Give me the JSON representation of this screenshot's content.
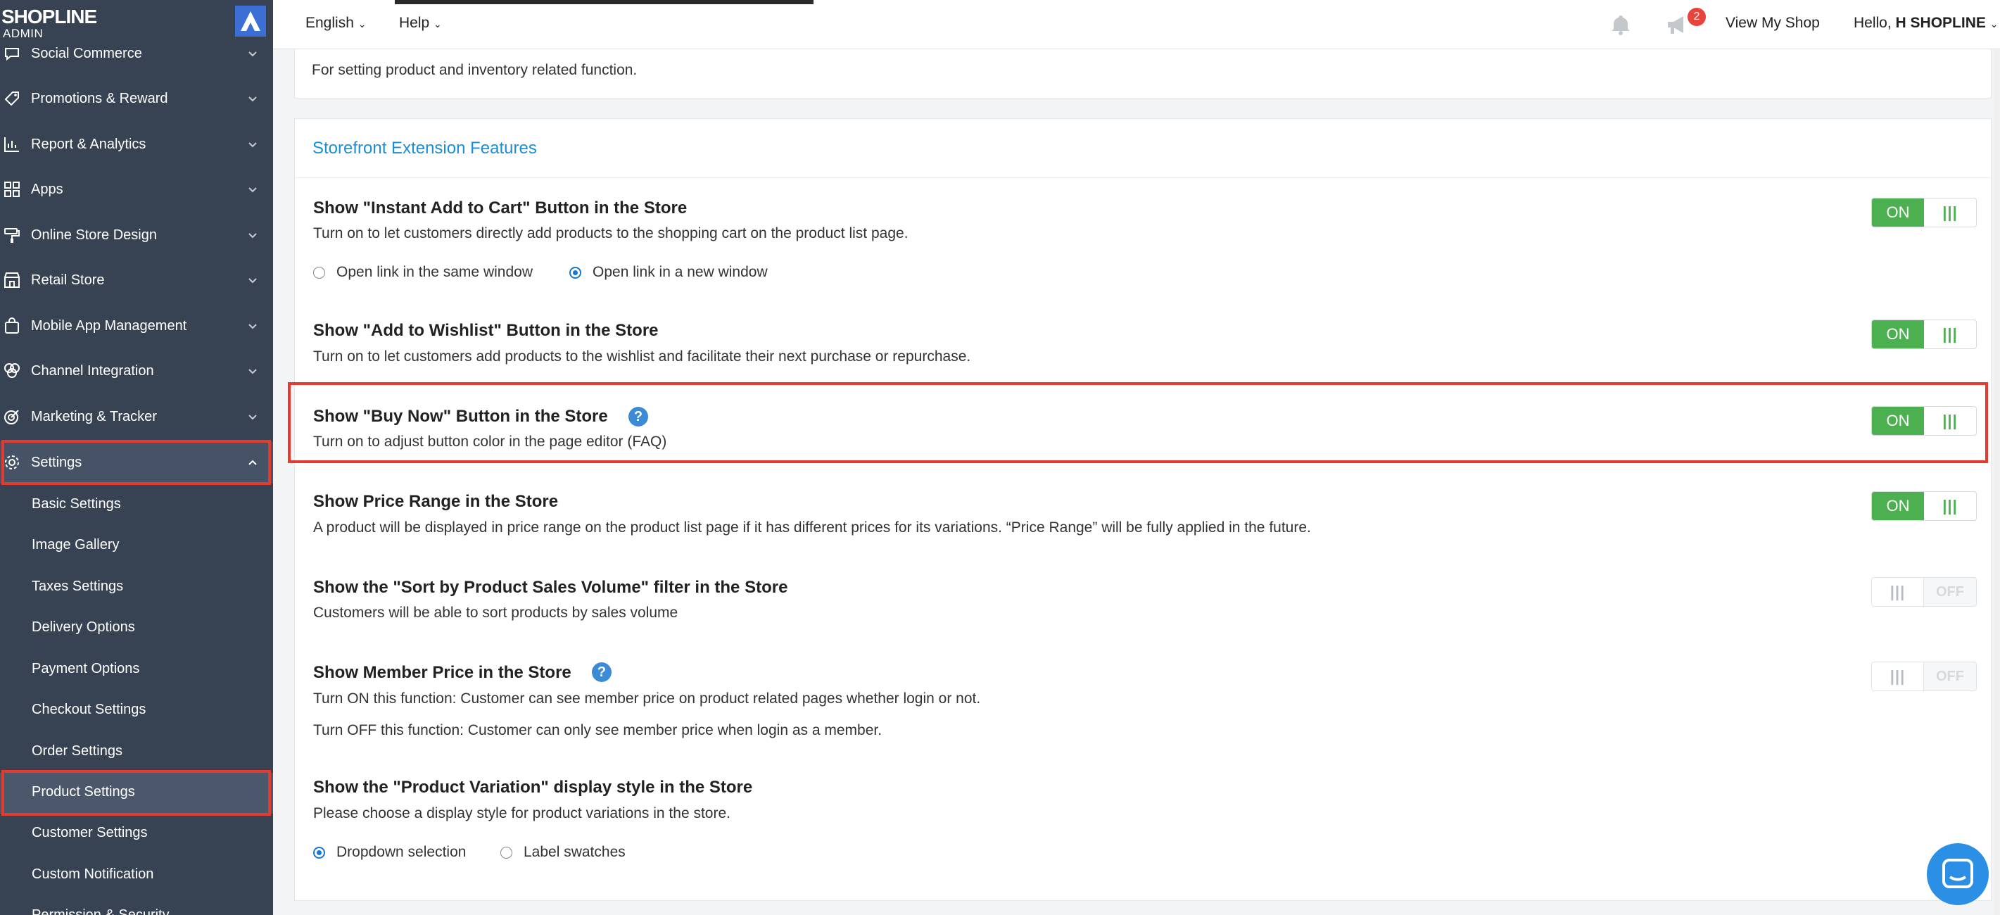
{
  "brand": {
    "name": "SHOPLINE",
    "sub": "ADMIN"
  },
  "sidebar": {
    "items": [
      {
        "label": "Social Commerce",
        "icon": "chat-bubble-icon"
      },
      {
        "label": "Promotions & Reward",
        "icon": "tag-icon"
      },
      {
        "label": "Report & Analytics",
        "icon": "bar-chart-icon"
      },
      {
        "label": "Apps",
        "icon": "apps-grid-icon"
      },
      {
        "label": "Online Store Design",
        "icon": "paint-roller-icon"
      },
      {
        "label": "Retail Store",
        "icon": "store-icon"
      },
      {
        "label": "Mobile App Management",
        "icon": "bag-icon"
      },
      {
        "label": "Channel Integration",
        "icon": "circles-icon"
      },
      {
        "label": "Marketing & Tracker",
        "icon": "target-icon"
      },
      {
        "label": "Settings",
        "icon": "gear-icon"
      }
    ],
    "sub_items": [
      {
        "label": "Basic Settings"
      },
      {
        "label": "Image Gallery"
      },
      {
        "label": "Taxes Settings"
      },
      {
        "label": "Delivery Options"
      },
      {
        "label": "Payment Options"
      },
      {
        "label": "Checkout Settings"
      },
      {
        "label": "Order Settings"
      },
      {
        "label": "Product Settings"
      },
      {
        "label": "Customer Settings"
      },
      {
        "label": "Custom Notification"
      },
      {
        "label": "Permission & Security"
      }
    ]
  },
  "topbar": {
    "language": "English",
    "help": "Help",
    "notification_count": "2",
    "view_shop": "View My Shop",
    "greeting_prefix": "Hello, ",
    "greeting_name": "H SHOPLINE"
  },
  "section_top": {
    "description": "For setting product and inventory related function."
  },
  "storefront": {
    "title": "Storefront Extension Features",
    "features": [
      {
        "title": "Show \"Instant Add to Cart\" Button in the Store",
        "desc": "Turn on to let customers directly add products to the shopping cart on the product list page.",
        "toggle": "ON",
        "radio_1": "Open link in the same window",
        "radio_2": "Open link in a new window"
      },
      {
        "title": "Show \"Add to Wishlist\" Button in the Store",
        "desc": "Turn on to let customers add products to the wishlist and facilitate their next purchase or repurchase.",
        "toggle": "ON"
      },
      {
        "title": "Show \"Buy Now\" Button in the Store",
        "desc": "Turn on to adjust button color in the page editor (FAQ)",
        "toggle": "ON"
      },
      {
        "title": "Show Price Range in the Store",
        "desc": "A product will be displayed in price range on the product list page if it has different prices for its variations. “Price Range” will be fully applied in the future.",
        "toggle": "ON"
      },
      {
        "title": "Show the \"Sort by Product Sales Volume\" filter in the Store",
        "desc": "Customers will be able to sort products by sales volume",
        "toggle": "OFF"
      },
      {
        "title": "Show Member Price in the Store",
        "desc": "Turn ON this function: Customer can see member price on product related pages whether login or not.",
        "desc2": "Turn OFF this function: Customer can only see member price when login as a member.",
        "toggle": "OFF"
      },
      {
        "title": "Show the \"Product Variation\" display style in the Store",
        "desc": "Please choose a display style for product variations in the store.",
        "radio_1": "Dropdown selection",
        "radio_2": "Label swatches"
      }
    ]
  },
  "colors": {
    "sidebar": "#374253",
    "accent_green": "#4caf50",
    "link_blue": "#1a8fd6",
    "highlight_red": "#e53a2f"
  }
}
